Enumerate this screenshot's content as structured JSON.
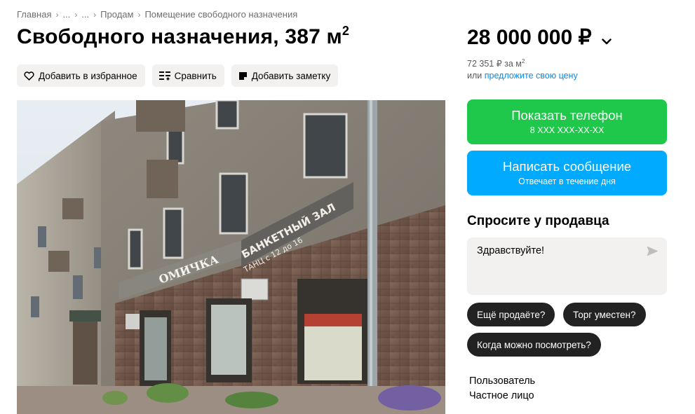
{
  "breadcrumb": {
    "items": [
      "Главная",
      "...",
      "...",
      "Продам",
      "Помещение свободного назначения"
    ],
    "separator": "›"
  },
  "title": {
    "text": "Свободного назначения, 387 м",
    "superscript": "2"
  },
  "actions": {
    "favorite_label": "Добавить в избранное",
    "compare_label": "Сравнить",
    "note_label": "Добавить заметку"
  },
  "price": {
    "value": "28 000 000 ₽",
    "per_unit": "72 351 ₽ за м",
    "per_unit_sup": "2",
    "offer_prefix": "или",
    "offer_link": "предложите свою цену"
  },
  "contact": {
    "phone_label": "Показать телефон",
    "phone_masked": "8 XXX XXX-XX-XX",
    "message_label": "Написать сообщение",
    "message_sub": "Отвечает в течение дня"
  },
  "ask": {
    "title": "Спросите у продавца",
    "message_value": "Здравствуйте!",
    "chips": [
      "Ещё продаёте?",
      "Торг уместен?",
      "Когда можно посмотреть?"
    ]
  },
  "seller": {
    "name": "Пользователь",
    "type": "Частное лицо"
  },
  "photo": {
    "sign_lines": [
      "БАНКЕТНЫЙ ЗАЛ",
      "ТАНЦ с 12 до 16"
    ],
    "sign_brand": "ОМИЧКА"
  },
  "colors": {
    "green": "#1fc84a",
    "blue": "#00aaff",
    "link": "#0a8be6",
    "chip": "#222222",
    "button_bg": "#f2f1f0"
  },
  "icons": [
    "heart-outline-icon",
    "compare-icon",
    "note-icon",
    "chevron-down-icon",
    "send-arrow-icon"
  ]
}
